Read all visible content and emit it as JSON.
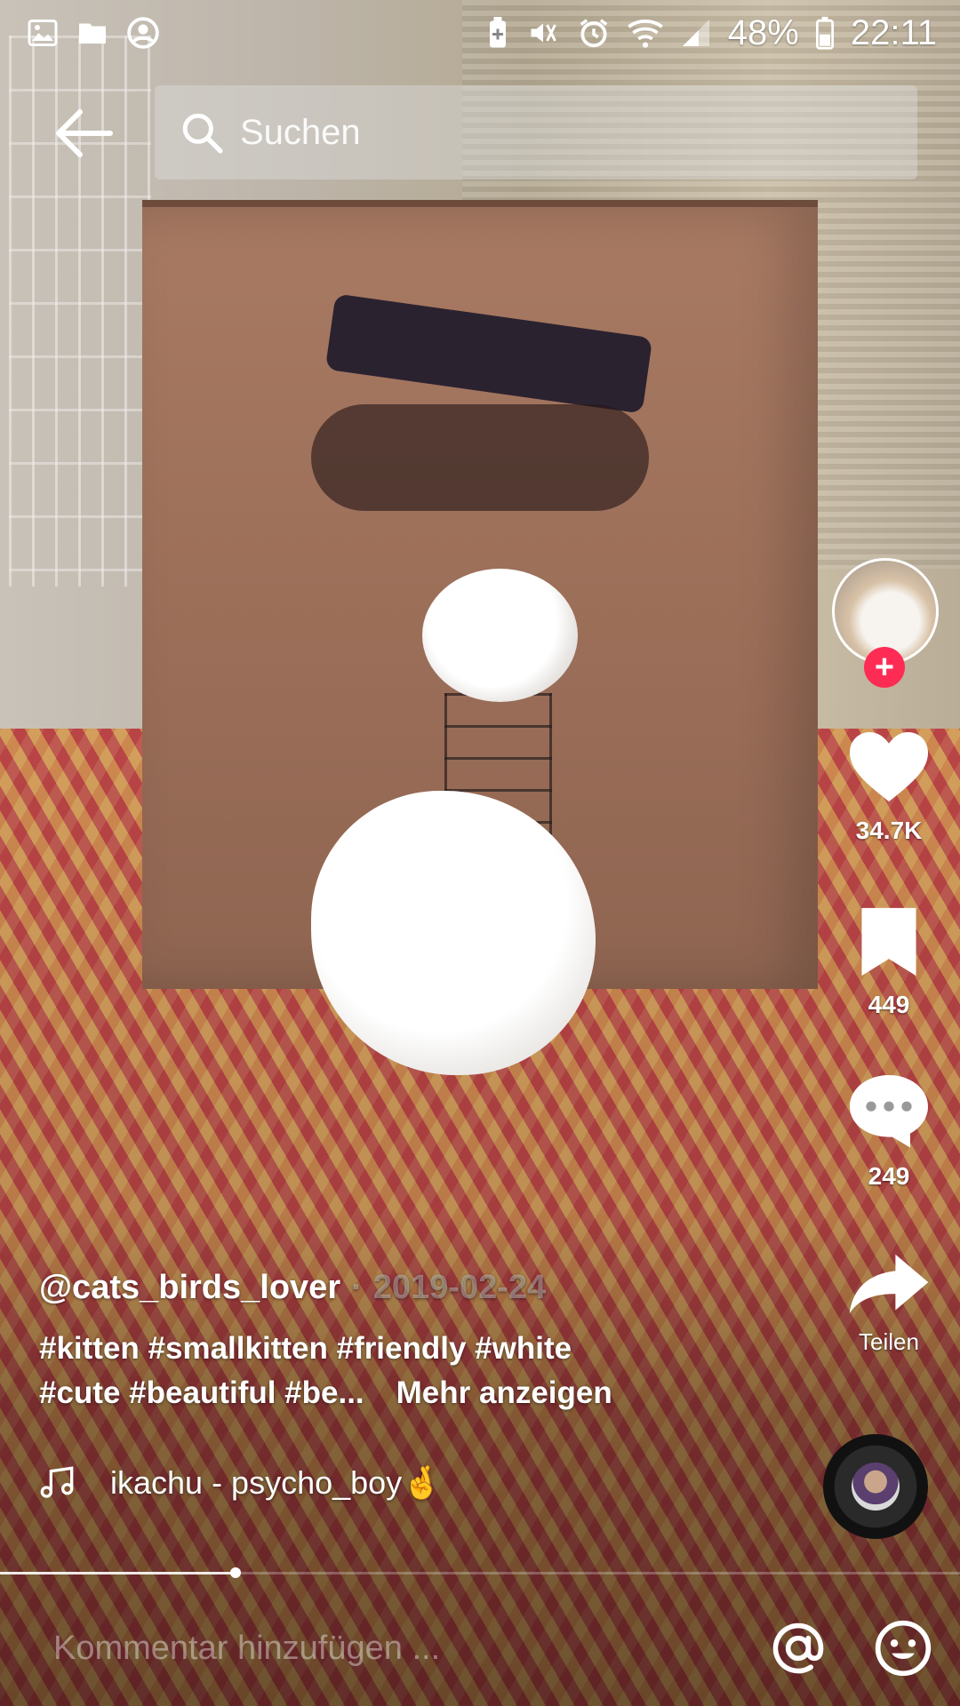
{
  "status_bar": {
    "battery": "48%",
    "time": "22:11",
    "icons_left": [
      "gallery-icon",
      "folder-icon",
      "account-circle-icon"
    ],
    "icons_right": [
      "battery-saver-icon",
      "mute-icon",
      "alarm-icon",
      "wifi-icon",
      "signal-icon",
      "battery-icon"
    ]
  },
  "top": {
    "search_placeholder": "Suchen"
  },
  "sidebar": {
    "likes": "34.7K",
    "favorites": "449",
    "comments": "249",
    "share_label": "Teilen"
  },
  "post": {
    "username": "@cats_birds_lover",
    "separator": "·",
    "date": "2019-02-24",
    "caption_line1": "#kitten #smallkitten #friendly #white",
    "caption_line2": "#cute #beautiful #be...",
    "more_label": "Mehr anzeigen",
    "music": "ikachu - psycho_boy🤞"
  },
  "playback": {
    "progress": 0.245
  },
  "comment_bar": {
    "placeholder": "Kommentar hinzufügen ..."
  },
  "colors": {
    "accent": "#fe2c55"
  }
}
